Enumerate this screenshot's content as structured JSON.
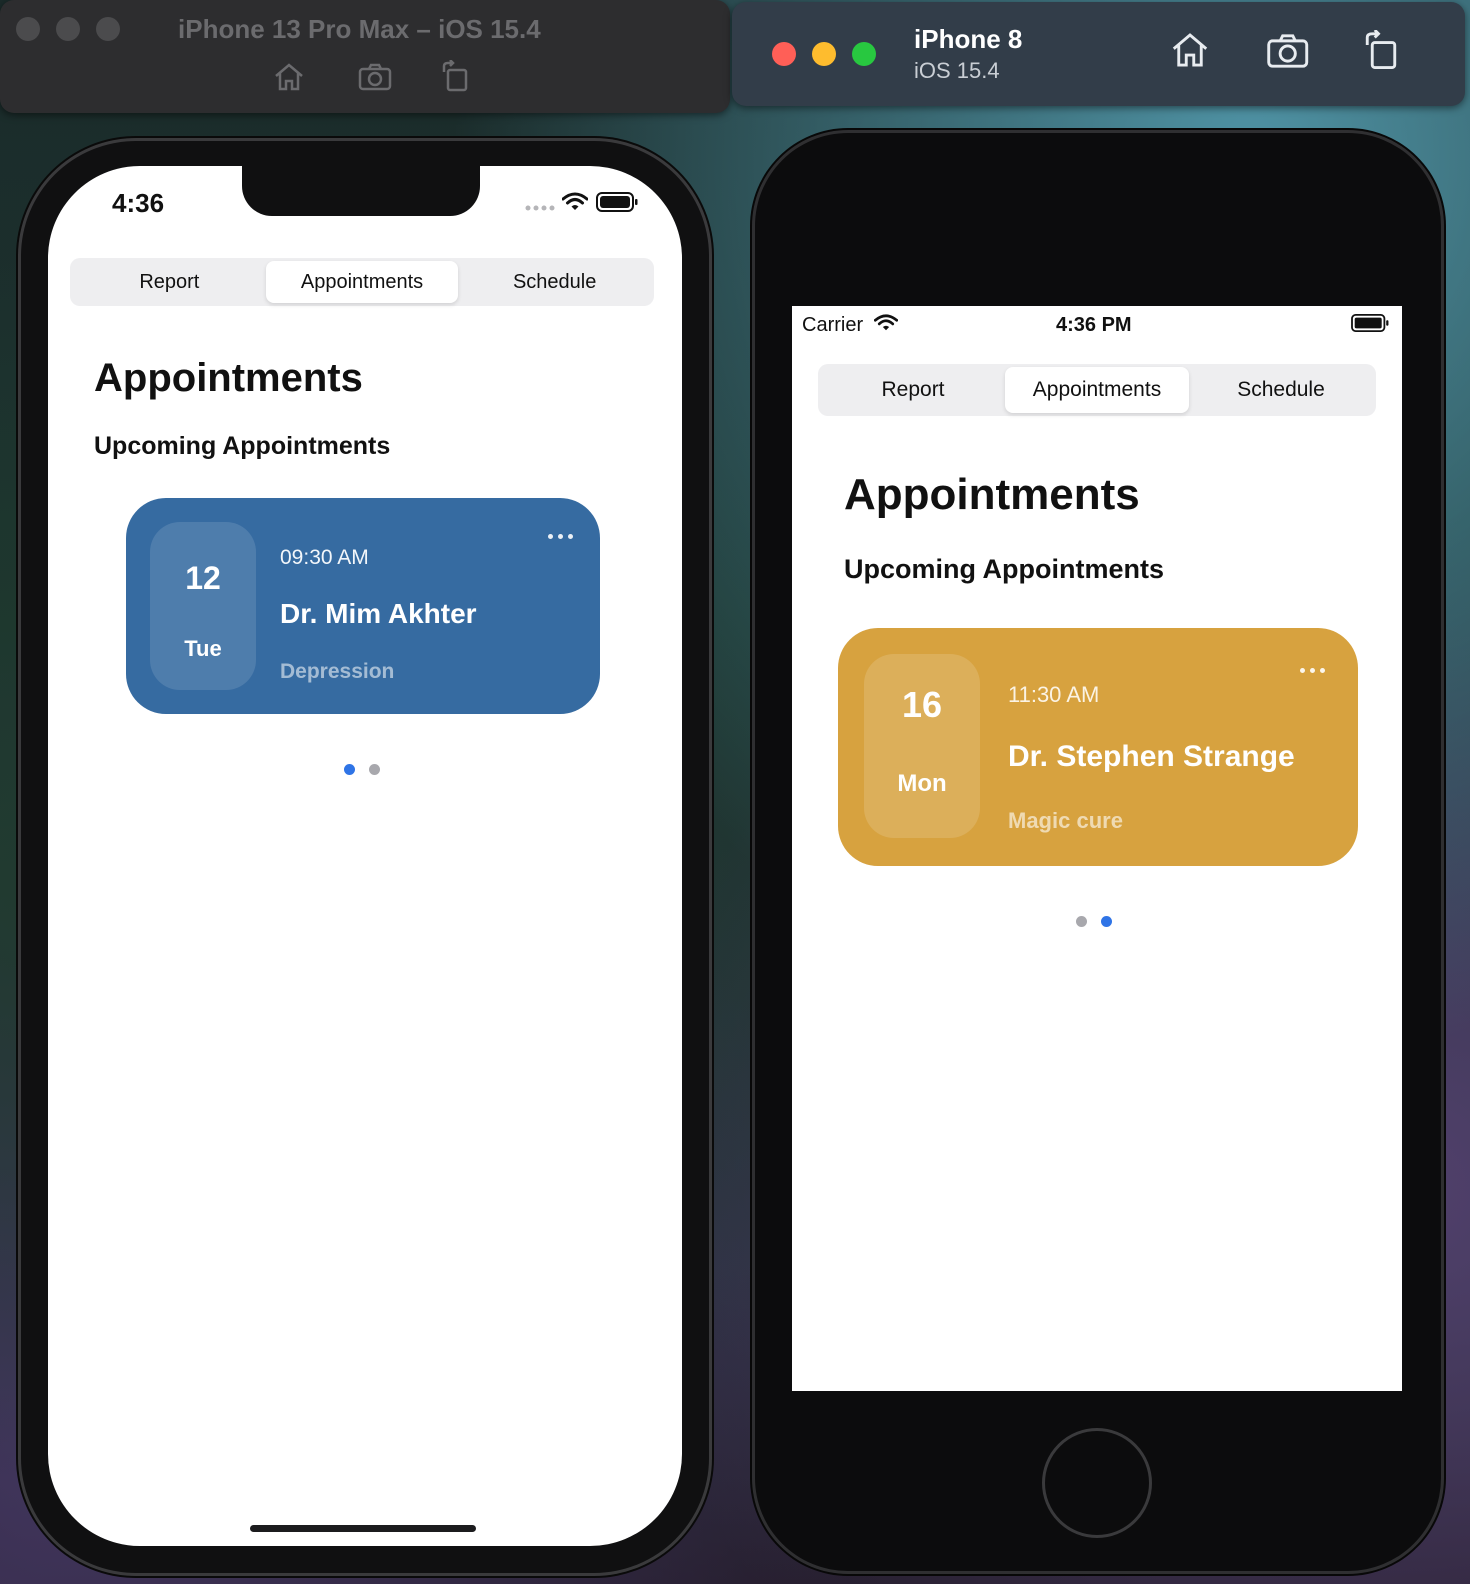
{
  "simulators": {
    "left_title": "iPhone 13 Pro Max – iOS 15.4",
    "right_title": "iPhone 8",
    "right_subtitle": "iOS 15.4"
  },
  "phone_13": {
    "status_time": "4:36",
    "tabs": [
      "Report",
      "Appointments",
      "Schedule"
    ],
    "active_tab": "Appointments",
    "title": "Appointments",
    "subtitle": "Upcoming Appointments",
    "card": {
      "date": "12",
      "day": "Tue",
      "time": "09:30 AM",
      "doctor": "Dr. Mim Akhter",
      "note": "Depression",
      "color": "#366ba1"
    },
    "page_index": 0,
    "page_count": 2
  },
  "phone_8": {
    "carrier": "Carrier",
    "status_time": "4:36 PM",
    "tabs": [
      "Report",
      "Appointments",
      "Schedule"
    ],
    "active_tab": "Appointments",
    "title": "Appointments",
    "subtitle": "Upcoming Appointments",
    "card": {
      "date": "16",
      "day": "Mon",
      "time": "11:30 AM",
      "doctor": "Dr. Stephen Strange",
      "note": "Magic cure",
      "color": "#d7a23f"
    },
    "page_index": 1,
    "page_count": 2
  },
  "colors": {
    "dot_active": "#2f74e6",
    "dot_inactive": "#a8a8ad"
  }
}
